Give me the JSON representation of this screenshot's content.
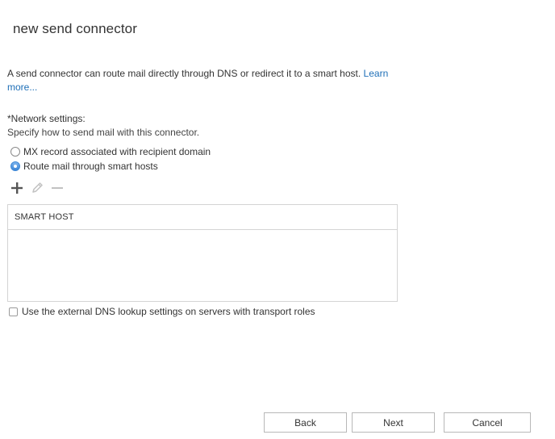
{
  "dialog": {
    "title": "new send connector"
  },
  "intro": {
    "text": "A send connector can route mail directly through DNS or redirect it to a smart host. ",
    "link": "Learn more..."
  },
  "network": {
    "label": "*Network settings:",
    "description": "Specify how to send mail with this connector.",
    "options": [
      {
        "label": "MX record associated with recipient domain",
        "selected": false
      },
      {
        "label": "Route mail through smart hosts",
        "selected": true
      }
    ]
  },
  "toolbar": {
    "add_icon": "plus-icon",
    "edit_icon": "pencil-icon",
    "remove_icon": "minus-icon"
  },
  "smart_hosts_grid": {
    "column_header": "SMART HOST",
    "rows": []
  },
  "external_dns": {
    "label": "Use the external DNS lookup settings on servers with transport roles",
    "checked": false
  },
  "footer": {
    "back_label": "Back",
    "next_label": "Next",
    "cancel_label": "Cancel"
  },
  "colors": {
    "link": "#1e6fb7",
    "radio_selected": "#3a84d5",
    "border": "#d4d4d4",
    "icon_enabled": "#555555",
    "icon_disabled": "#c2c2c2"
  }
}
